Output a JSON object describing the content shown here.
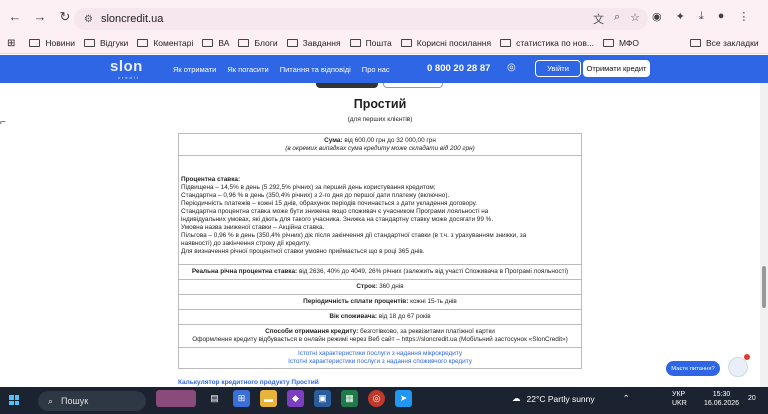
{
  "browser": {
    "url": "sloncredit.ua",
    "bookmarks": [
      "Новини",
      "Відгуки",
      "Коментарі",
      "ВА",
      "Блоги",
      "Завдання",
      "Пошта",
      "Корисні посилання",
      "статистика по нов...",
      "МФО"
    ],
    "all_bookmarks": "Все закладки"
  },
  "site": {
    "logo": "slon",
    "logo_sub": "credit",
    "nav": [
      "Як отримати",
      "Як погасити",
      "Питання та відповіді",
      "Про нас"
    ],
    "phone": "0 800 20 28 87",
    "login": "Увійти",
    "get_credit": "Отримати кредит"
  },
  "content": {
    "title": "Простий",
    "subtitle": "(для перших клієнтів)",
    "amount_label": "Сума:",
    "amount_value": " від 600,00 грн до 32 000,00 грн",
    "amount_note": "(в окремих випадках сума кредиту може складати від 200 грн)",
    "rate_title": "Процентна ставка:",
    "rate_lines": [
      "Підвищена  – 14,5% в день  (5 292,5% річних) за перший день користування кредитом;",
      "Стандартна – 0,96 % в день (350,4% річних)  з 2-го дня до першої дати платежу (включно).",
      "Періодичність платежів – кожні 15 днів, обрахунок періодів починається  з дати укладення договору.",
      "Стандартна процентна ставка може бути знижена якщо споживач є учасником Програми лояльності на",
      "індивідуальних  умовах, які діють для такого учасника. Знижка на стандартну ставку може досягати 99 %.",
      "Умовна назва зниженої ставки – Акційна ставка.",
      "Пільгова – 0,96 % в день (350,4% річних)  діє після закінчення дії стандартної ставки (в т.ч. з урахуванням знижки, за",
      "наявності)  до закінчення строку дії кредиту.",
      "Для визначення річної процентної ставки умовно приймається що в році 365 днів."
    ],
    "real_rate_label": "Реальна річна процентна ставка:",
    "real_rate_value": " від 2636, 40% до 4049, 26% річних (залежить від участі Споживача в Програмі лояльності)",
    "term_label": "Строк:",
    "term_value": " 360 днів",
    "period_label": "Періодичність сплати процентів:",
    "period_value": " кожні 15-ть днів",
    "age_label": "Вік споживача:",
    "age_value": " від 18 до 67 років",
    "methods_label": "Способи отримання кредиту:",
    "methods_value": " безготівково, за реквізитами платіжної картки",
    "methods_online": "Оформлення кредиту відбувається в онлайн режимі через Веб сайт – https://sloncredit.ua (Мобільний застосунок «SlonCredit»)",
    "link1": "Істотні характеристики послуги з надання мікрокредиту",
    "link2": "Істотні характеристики послуги з надання споживчого кредиту",
    "calc_link": "Калькулятор кредитного продукту Простий"
  },
  "chat": {
    "label": "Маєте питання?"
  },
  "taskbar": {
    "search": "Пошук",
    "weather": "22°C  Partly sunny",
    "lang": "УКР",
    "lang2": "UKR",
    "time": "15:30",
    "date": "16.06.2026",
    "notif": "20"
  }
}
